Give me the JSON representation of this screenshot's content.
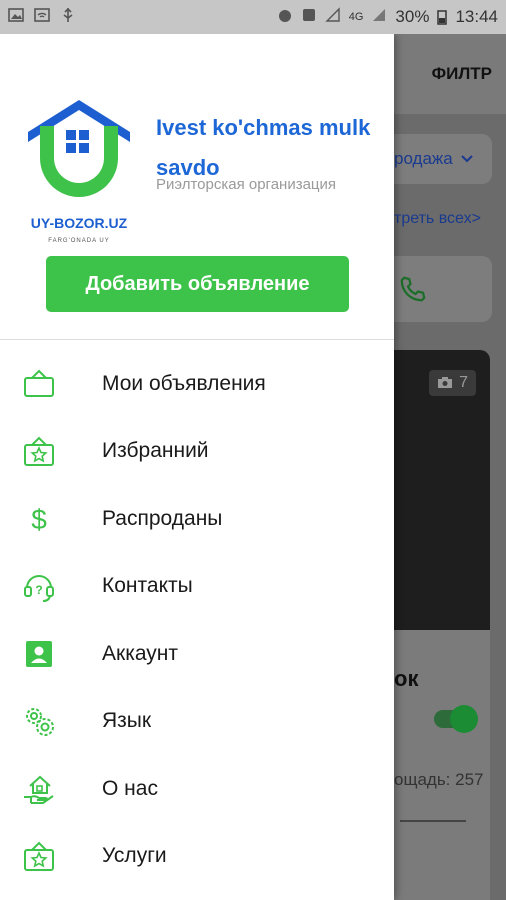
{
  "status_bar": {
    "battery": "30%",
    "time": "13:44",
    "network": "4G"
  },
  "background_app": {
    "filter_label": "ФИЛТР",
    "dropdown_value": "родажа",
    "see_all_link": "треть всех>",
    "photo_count": "7",
    "title_fragment": "ок",
    "area_fragment": "ощадь: 257"
  },
  "drawer": {
    "logo_text": "UY-BOZOR.UZ",
    "logo_subtext": "FARG'ONADA UY",
    "org_name": "Ivest ko'chmas mulk savdo",
    "org_subtitle": "Риэлторская организация",
    "add_button_label": "Добавить объявление",
    "menu": [
      {
        "label": "Мои объявления",
        "icon": "frame-icon"
      },
      {
        "label": "Избранний",
        "icon": "star-frame-icon"
      },
      {
        "label": "Распроданы",
        "icon": "dollar-icon"
      },
      {
        "label": "Контакты",
        "icon": "support-headset-icon"
      },
      {
        "label": "Аккаунт",
        "icon": "account-box-icon"
      },
      {
        "label": "Язык",
        "icon": "gears-icon"
      },
      {
        "label": "О нас",
        "icon": "house-hand-icon"
      },
      {
        "label": "Услуги",
        "icon": "star-frame-icon"
      }
    ]
  },
  "colors": {
    "accent_green": "#3ec34a",
    "brand_blue": "#1d67d6",
    "drawer_bg": "#ffffff",
    "statusbar_bg": "#c6c6c6"
  }
}
